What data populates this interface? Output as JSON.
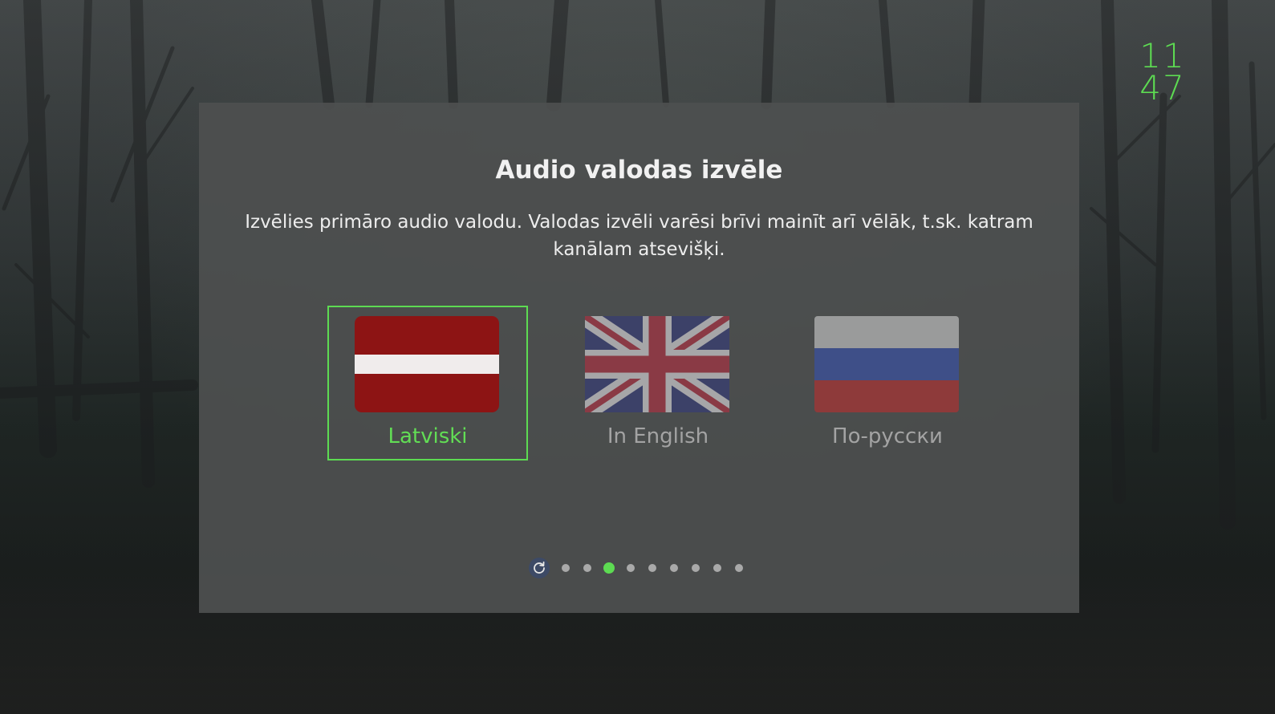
{
  "clock": {
    "hours": "11",
    "minutes": "47"
  },
  "dialog": {
    "title": "Audio valodas izvēle",
    "description": "Izvēlies primāro audio valodu. Valodas izvēli varēsi brīvi mainīt arī vēlāk, t.sk. katram kanālam atsevišķi.",
    "options": [
      {
        "label": "Latviski",
        "flag": "latvia-flag-icon",
        "selected": true
      },
      {
        "label": "In English",
        "flag": "uk-flag-icon",
        "selected": false
      },
      {
        "label": "По-русски",
        "flag": "russia-flag-icon",
        "selected": false
      }
    ]
  },
  "pager": {
    "restart_icon": "restart-icon",
    "total_steps": 9,
    "active_step": 3
  },
  "colors": {
    "accent": "#5ddb52",
    "dialog_background": "#4e5050",
    "inactive_label": "#a3a3a3"
  }
}
